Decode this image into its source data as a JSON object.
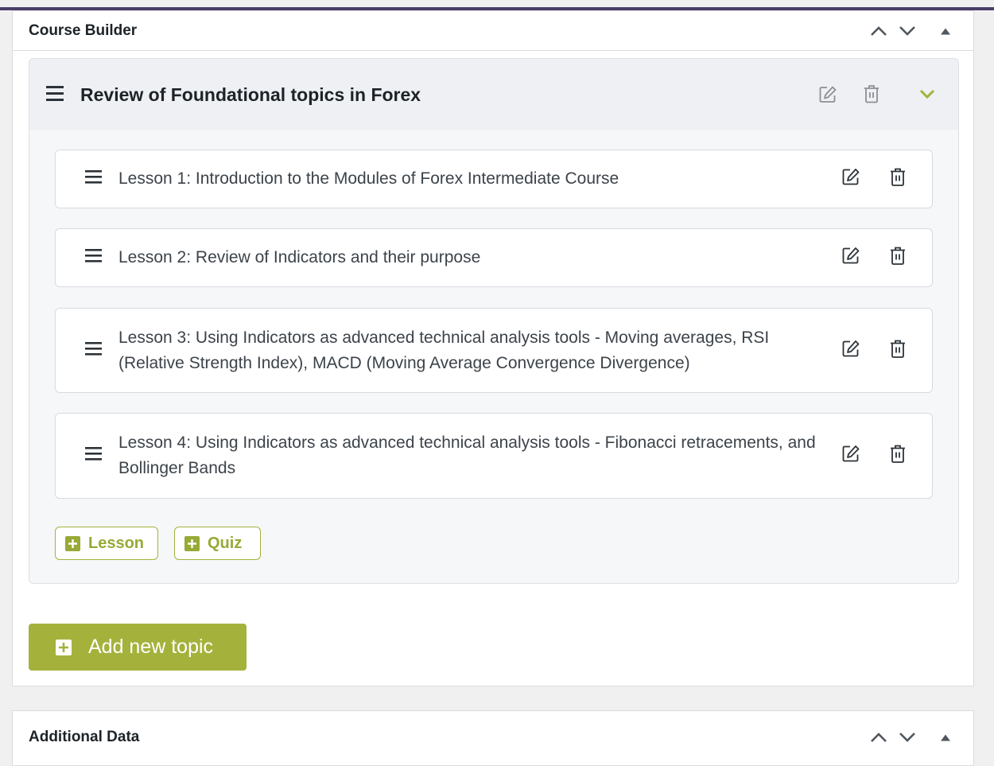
{
  "colors": {
    "accent_green": "#a4b23c",
    "admin_bar": "#4a3f68",
    "panel_bg": "#f0f0f1"
  },
  "course_builder": {
    "title": "Course Builder",
    "controls": [
      "chevron-up-icon",
      "chevron-down-icon",
      "collapse-arrow-icon"
    ],
    "topic": {
      "title": "Review of Foundational topics in Forex",
      "icons": [
        "drag-handle-icon",
        "edit-icon",
        "trash-icon",
        "chevron-down-icon"
      ],
      "lessons": [
        {
          "label": "Lesson 1: Introduction to the Modules of Forex Intermediate Course"
        },
        {
          "label": "Lesson 2: Review of Indicators and their purpose"
        },
        {
          "label": "Lesson 3: Using Indicators as advanced technical analysis tools - Moving averages, RSI (Relative Strength Index), MACD (Moving Average Convergence Divergence)"
        },
        {
          "label": "Lesson 4: Using Indicators as advanced technical analysis tools - Fibonacci retracements, and Bollinger Bands"
        }
      ],
      "add_lesson_label": "Lesson",
      "add_quiz_label": "Quiz"
    },
    "add_topic_label": "Add new topic"
  },
  "additional_data": {
    "title": "Additional Data"
  }
}
